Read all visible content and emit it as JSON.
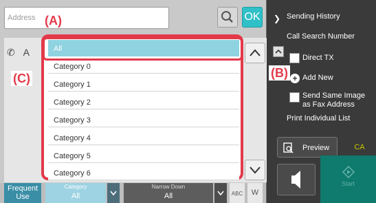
{
  "address_bar": {
    "placeholder": "Address"
  },
  "buttons": {
    "ok": "OK"
  },
  "callouts": {
    "a": "(A)",
    "b": "(B)",
    "c": "(C)"
  },
  "contact_row_initial": "A",
  "dropdown": {
    "selected": "All",
    "items": [
      "Category 0",
      "Category 1",
      "Category 2",
      "Category 3",
      "Category 4",
      "Category 5",
      "Category 6"
    ]
  },
  "bottom": {
    "frequent_use": "Frequent Use",
    "category_label": "Category",
    "category_value": "All",
    "narrow_down_label": "Narrow Down",
    "narrow_down_value": "All",
    "abc": "ABC",
    "w": "W"
  },
  "right_panel": {
    "sending_history": "Sending History",
    "call_search_number": "Call Search Number",
    "direct_tx": "Direct TX",
    "add_new": "Add New",
    "send_same_image": "Send Same Image as Fax Address",
    "print_individual_list": "Print Individual List",
    "preview": "Preview",
    "ca": "CA",
    "start": "Start"
  },
  "colors": {
    "accent": "#2fc0c8",
    "highlight": "#e23a4a",
    "selected": "#8fd3e0"
  }
}
